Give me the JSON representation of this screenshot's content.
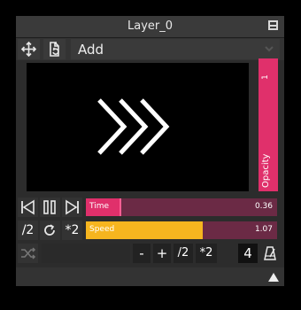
{
  "window": {
    "title": "Layer_0"
  },
  "blend": {
    "mode": "Add"
  },
  "opacity": {
    "label": "Opacity",
    "value": "1"
  },
  "time": {
    "label": "Time",
    "value": "0.36",
    "progress": 0.18
  },
  "speed": {
    "label": "Speed",
    "value": "1.07",
    "progress": 0.61
  },
  "transport": {
    "half_label": "/2",
    "double_label": "*2"
  },
  "tempo": {
    "minus_label": "-",
    "plus_label": "+",
    "half_label": "/2",
    "double_label": "*2",
    "beats": "4"
  },
  "colors": {
    "accent": "#e0306b",
    "track": "#6b2a45",
    "speed_fill": "#f6b51f",
    "panel": "#2c2c2c"
  },
  "icons": [
    "move-icon",
    "replace-file-icon",
    "chevron-down-icon",
    "maximize-icon",
    "skip-back-icon",
    "pause-icon",
    "skip-forward-icon",
    "loop-icon",
    "shuffle-icon",
    "metronome-icon",
    "resize-grip-icon"
  ]
}
